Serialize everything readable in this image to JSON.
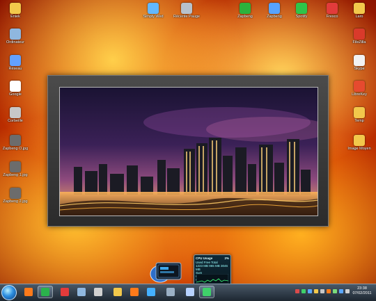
{
  "desktop": {
    "icons_left": [
      {
        "label": "Eniek",
        "color": "#f2c84b"
      },
      {
        "label": "Ordinateur",
        "color": "#8fb7df"
      },
      {
        "label": "Réseau",
        "color": "#63a1ff"
      },
      {
        "label": "Google",
        "color": "#ffffff"
      },
      {
        "label": "Corbeille",
        "color": "#c7c7c7"
      },
      {
        "label": "Zapbeng O.jpg",
        "color": "#6c6c6c"
      },
      {
        "label": "Zapbeng 1.jpg",
        "color": "#6c6c6c"
      },
      {
        "label": "Zapbeng 2.jpg",
        "color": "#6c6c6c"
      }
    ],
    "icons_top": [
      {
        "label": "Simply Wed",
        "color": "#62b8ff"
      },
      {
        "label": "Récente Pauge",
        "color": "#b7c1cc"
      },
      {
        "label": "Zapbeng",
        "color": "#2db23c"
      },
      {
        "label": "Zapbeng",
        "color": "#57a3ff"
      },
      {
        "label": "Spotify",
        "color": "#2ec449"
      },
      {
        "label": "Fresco",
        "color": "#e23b3b"
      },
      {
        "label": "Laro",
        "color": "#f2c84b"
      }
    ],
    "icons_right": [
      {
        "label": "FileZilla",
        "color": "#d93a2b"
      },
      {
        "label": "Skype",
        "color": "#f2f2f2"
      },
      {
        "label": "LibreKey",
        "color": "#e64a2f"
      },
      {
        "label": "Temp",
        "color": "#f2c84b"
      },
      {
        "label": "Image Moyen",
        "color": "#f2c84b"
      }
    ]
  },
  "cpu_gadget": {
    "title": "CPU Usage",
    "value": "2%",
    "stats": [
      "Used  Free  Total",
      "1223 MB  965 MB  3046 MB",
      "Sum",
      "Core 1",
      "Core 2"
    ]
  },
  "taskbar": {
    "time": "23:38",
    "date": "07/02/2011"
  }
}
